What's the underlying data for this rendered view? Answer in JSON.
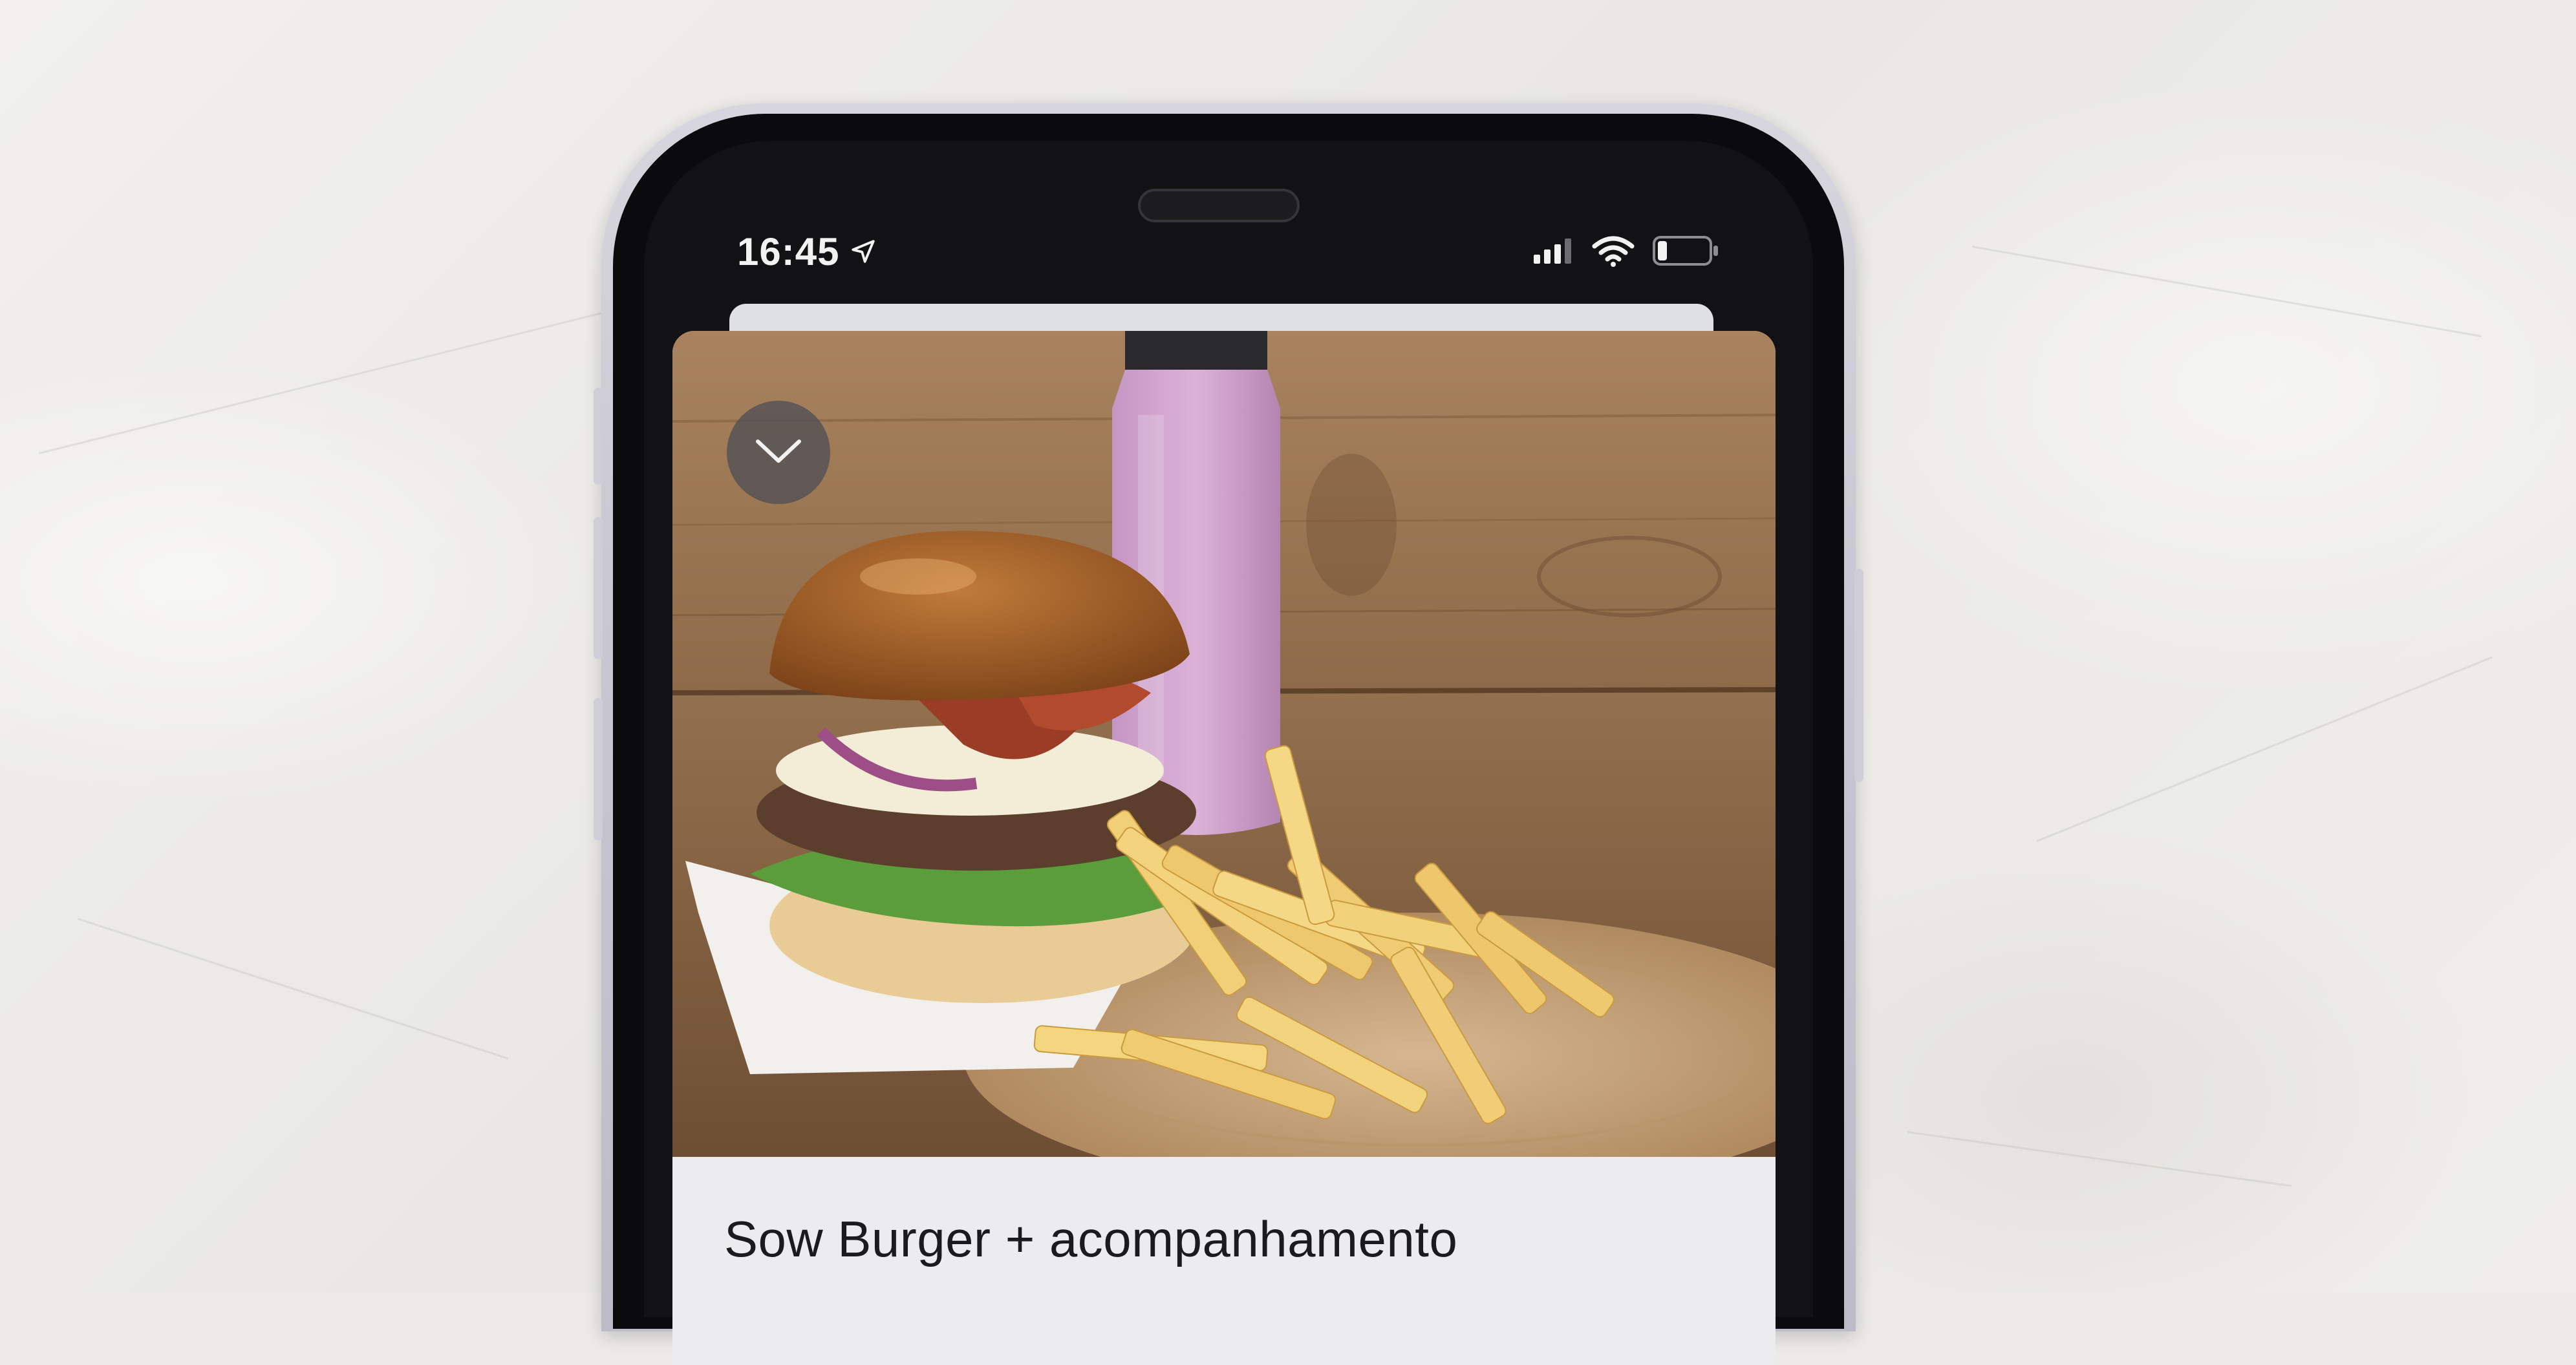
{
  "status_bar": {
    "time": "16:45",
    "location_icon": "location-arrow-icon",
    "signal_icon": "cellular-signal-icon",
    "wifi_icon": "wifi-icon",
    "battery_icon": "battery-icon"
  },
  "product": {
    "title": "Sow Burger + acompanhamento",
    "image_icon": "burger-fries-photo",
    "collapse_icon": "chevron-down-icon"
  },
  "colors": {
    "screen": "#121214",
    "card": "#ececef",
    "phone_frame": "#c9c8d2",
    "status_text": "#f2f2f2"
  }
}
